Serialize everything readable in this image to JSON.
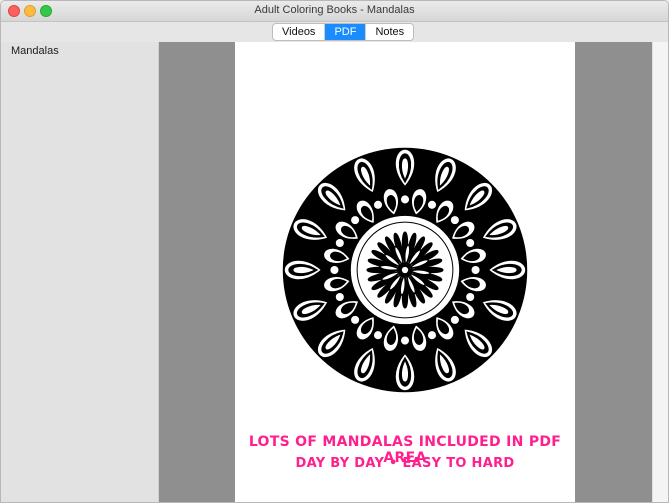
{
  "window": {
    "title": "Adult Coloring Books - Mandalas"
  },
  "toolbar": {
    "tabs": [
      {
        "label": "Videos",
        "active": false
      },
      {
        "label": "PDF",
        "active": true
      },
      {
        "label": "Notes",
        "active": false
      }
    ]
  },
  "sidebar": {
    "items": [
      {
        "label": "Mandalas"
      }
    ]
  },
  "pdf": {
    "caption_line1": "LOTS OF MANDALAS INCLUDED IN PDF AREA",
    "caption_line2": "DAY BY DAY • EASY TO HARD"
  },
  "colors": {
    "accent": "#1a8cff",
    "caption": "#ff1f8f"
  }
}
